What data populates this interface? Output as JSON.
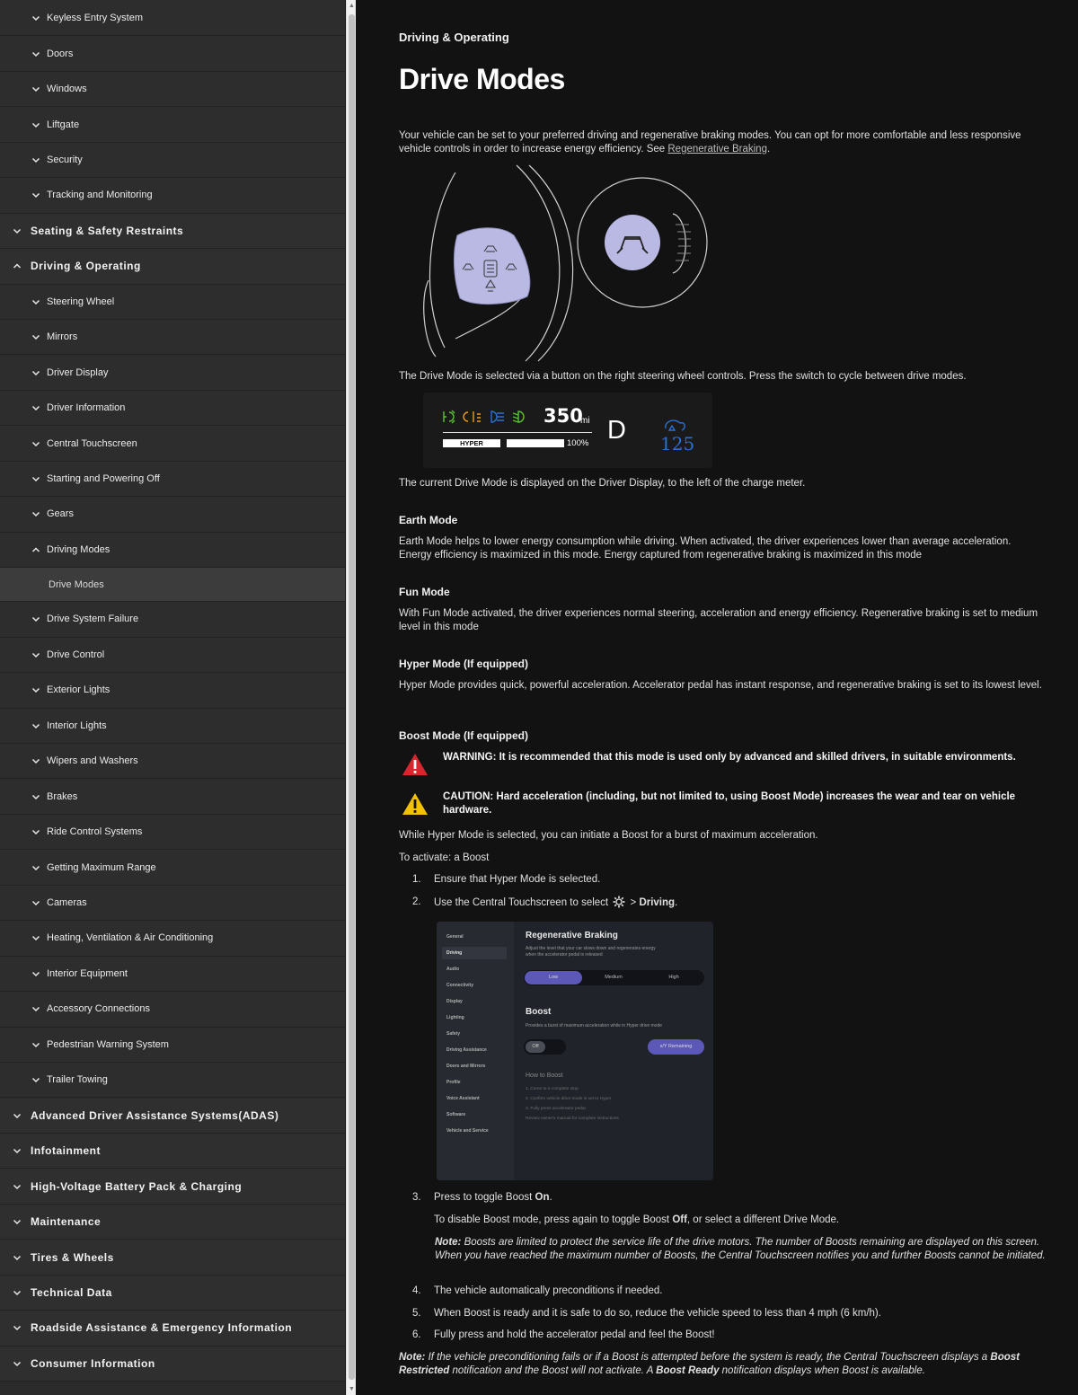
{
  "sidebar": {
    "items": [
      {
        "level": 2,
        "label": "Keyless Entry System",
        "state": "collapsed"
      },
      {
        "level": 2,
        "label": "Doors",
        "state": "collapsed"
      },
      {
        "level": 2,
        "label": "Windows",
        "state": "collapsed"
      },
      {
        "level": 2,
        "label": "Liftgate",
        "state": "collapsed"
      },
      {
        "level": 2,
        "label": "Security",
        "state": "collapsed"
      },
      {
        "level": 2,
        "label": "Tracking and Monitoring",
        "state": "collapsed"
      },
      {
        "level": 1,
        "label": "Seating & Safety Restraints",
        "state": "collapsed"
      },
      {
        "level": 1,
        "label": "Driving & Operating",
        "state": "expanded"
      },
      {
        "level": 2,
        "label": "Steering Wheel",
        "state": "collapsed"
      },
      {
        "level": 2,
        "label": "Mirrors",
        "state": "collapsed"
      },
      {
        "level": 2,
        "label": "Driver Display",
        "state": "collapsed"
      },
      {
        "level": 2,
        "label": "Driver Information",
        "state": "collapsed"
      },
      {
        "level": 2,
        "label": "Central Touchscreen",
        "state": "collapsed"
      },
      {
        "level": 2,
        "label": "Starting and Powering Off",
        "state": "collapsed"
      },
      {
        "level": 2,
        "label": "Gears",
        "state": "collapsed"
      },
      {
        "level": 2,
        "label": "Driving Modes",
        "state": "expanded"
      },
      {
        "level": 3,
        "label": "Drive Modes",
        "state": "selected"
      },
      {
        "level": 2,
        "label": "Drive System Failure",
        "state": "collapsed"
      },
      {
        "level": 2,
        "label": "Drive Control",
        "state": "collapsed"
      },
      {
        "level": 2,
        "label": "Exterior Lights",
        "state": "collapsed"
      },
      {
        "level": 2,
        "label": "Interior Lights",
        "state": "collapsed"
      },
      {
        "level": 2,
        "label": "Wipers and Washers",
        "state": "collapsed"
      },
      {
        "level": 2,
        "label": "Brakes",
        "state": "collapsed"
      },
      {
        "level": 2,
        "label": "Ride Control Systems",
        "state": "collapsed"
      },
      {
        "level": 2,
        "label": "Getting Maximum Range",
        "state": "collapsed"
      },
      {
        "level": 2,
        "label": "Cameras",
        "state": "collapsed"
      },
      {
        "level": 2,
        "label": "Heating, Ventilation & Air Conditioning",
        "state": "collapsed"
      },
      {
        "level": 2,
        "label": "Interior Equipment",
        "state": "collapsed"
      },
      {
        "level": 2,
        "label": "Accessory Connections",
        "state": "collapsed"
      },
      {
        "level": 2,
        "label": "Pedestrian Warning System",
        "state": "collapsed"
      },
      {
        "level": 2,
        "label": "Trailer Towing",
        "state": "collapsed"
      },
      {
        "level": 1,
        "label": "Advanced Driver Assistance Systems(ADAS)",
        "state": "collapsed"
      },
      {
        "level": 1,
        "label": "Infotainment",
        "state": "collapsed"
      },
      {
        "level": 1,
        "label": "High-Voltage Battery Pack & Charging",
        "state": "collapsed"
      },
      {
        "level": 1,
        "label": "Maintenance",
        "state": "collapsed"
      },
      {
        "level": 1,
        "label": "Tires & Wheels",
        "state": "collapsed"
      },
      {
        "level": 1,
        "label": "Technical Data",
        "state": "collapsed"
      },
      {
        "level": 1,
        "label": "Roadside Assistance & Emergency Information",
        "state": "collapsed"
      },
      {
        "level": 1,
        "label": "Consumer Information",
        "state": "collapsed"
      }
    ]
  },
  "article": {
    "breadcrumb": "Driving & Operating",
    "title": "Drive Modes",
    "intro": "Your vehicle can be set to your preferred driving and regenerative braking modes. You can opt for more comfortable and less responsive vehicle controls in order to increase energy efficiency. See ",
    "intro_link": "Regenerative Braking",
    "intro_end": ".",
    "caption1": "The Drive Mode is selected via a button on the right steering wheel controls. Press the switch to cycle between drive modes.",
    "display": {
      "range_value": "350",
      "range_unit": "mi",
      "mode_label": "HYPER",
      "charge_percent": "100%",
      "charge_fraction": 1.0,
      "gear": "D",
      "boost_count": "125"
    },
    "caption2": "The current Drive Mode is displayed on the Driver Display, to the left of the charge meter.",
    "earth_title": "Earth Mode",
    "earth_body": "Earth Mode helps to lower energy consumption while driving. When activated, the driver experiences lower than average acceleration. Energy efficiency is maximized in this mode. Energy captured from regenerative braking is maximized in this mode",
    "fun_title": "Fun Mode",
    "fun_body": "With Fun Mode activated, the driver experiences normal steering, acceleration and energy efficiency. Regenerative braking is set to medium level in this mode",
    "hyper_title": "Hyper Mode (If equipped)",
    "hyper_body": "Hyper Mode provides quick, powerful acceleration. Accelerator pedal has instant response, and regenerative braking is set to its lowest level.",
    "boost_title": "Boost Mode (If equipped)",
    "warning": "WARNING: It is recommended that this mode is used only by advanced and skilled drivers, in suitable environments.",
    "caution": "CAUTION: Hard acceleration (including, but not limited to, using Boost Mode) increases the wear and tear on vehicle hardware.",
    "boost_intro": "While Hyper Mode is selected, you can initiate a Boost for a burst of maximum acceleration.",
    "activate_title": "To activate: a Boost",
    "step1_num": "1.",
    "step1": "Ensure that Hyper Mode is selected.",
    "step2_num": "2.",
    "step2_pre": "Use the Central Touchscreen to select",
    "step2_sep": " > ",
    "step2_bold": "Driving",
    "step2_end": ".",
    "step3_num": "3.",
    "step3_pre": "Press to toggle Boost ",
    "step3_bold": "On",
    "step3_end": ".",
    "disable_pre": "To disable Boost mode, press again to toggle Boost ",
    "disable_bold": "Off",
    "disable_end": ", or select a different Drive Mode.",
    "note1_label": "Note:",
    "note1": " Boosts are limited to protect the service life of the drive motors. The number of Boosts remaining are displayed on this screen. When you have reached the maximum number of Boosts, the Central Touchscreen notifies you and further Boosts cannot be initiated.",
    "step4_num": "4.",
    "step4": "The vehicle automatically preconditions if needed.",
    "step5_num": "5.",
    "step5": "When Boost is ready and it is safe to do so, reduce the vehicle speed to less than 4 mph (6 km/h).",
    "step6_num": "6.",
    "step6": "Fully press and hold the accelerator pedal and feel the Boost!",
    "note2_label": "Note:",
    "note2_a": " If the vehicle preconditioning fails or if a Boost is attempted before the system is ready, the Central Touchscreen displays a ",
    "note2_b": "Boost Restricted",
    "note2_c": " notification and the Boost will not activate. A ",
    "note2_d": "Boost Ready",
    "note2_e": " notification displays when Boost is available."
  },
  "touchscreen": {
    "menu": [
      "General",
      "Driving",
      "Audio",
      "Connectivity",
      "Display",
      "Lighting",
      "Safety",
      "Driving Assistance",
      "Doors and Mirrors",
      "Profile",
      "Voice Assistant",
      "Software",
      "Vehicle and Service"
    ],
    "selected_menu": "Driving",
    "regen_title": "Regenerative Braking",
    "regen_desc_1": "Adjust the level that your car slows down and regenerates energy",
    "regen_desc_2": "when the accelerator pedal is released",
    "regen_options": [
      "Low",
      "Medium",
      "High"
    ],
    "regen_selected": "Low",
    "boost_title": "Boost",
    "boost_desc": "Provides a burst of maximum acceleration while in Hyper drive mode",
    "boost_toggle": "Off",
    "boost_remaining": "x/Y Remaining",
    "howto_title": "How to Boost",
    "howto_1": "1. Come to a complete stop",
    "howto_2": "2. Confirm vehicle drive mode is set to Hyper",
    "howto_3": "3. Fully press accelerator pedal",
    "howto_4": "Review owner's manual for complete instructions"
  },
  "colors": {
    "page_bg": "#121212",
    "sidebar_bg": "#2b2b2b",
    "selected_row": "#3c3c3c",
    "accent_lavender": "#b9b9e3",
    "warning_red": "#d7262e",
    "caution_yellow": "#f2c200",
    "display_blue": "#2a6fd6",
    "toggle_purple": "#5b58b8"
  },
  "icons": [
    "chevron-down-icon",
    "chevron-up-icon",
    "drive-mode-icon",
    "warning-icon",
    "caution-icon",
    "settings-gear-icon"
  ]
}
